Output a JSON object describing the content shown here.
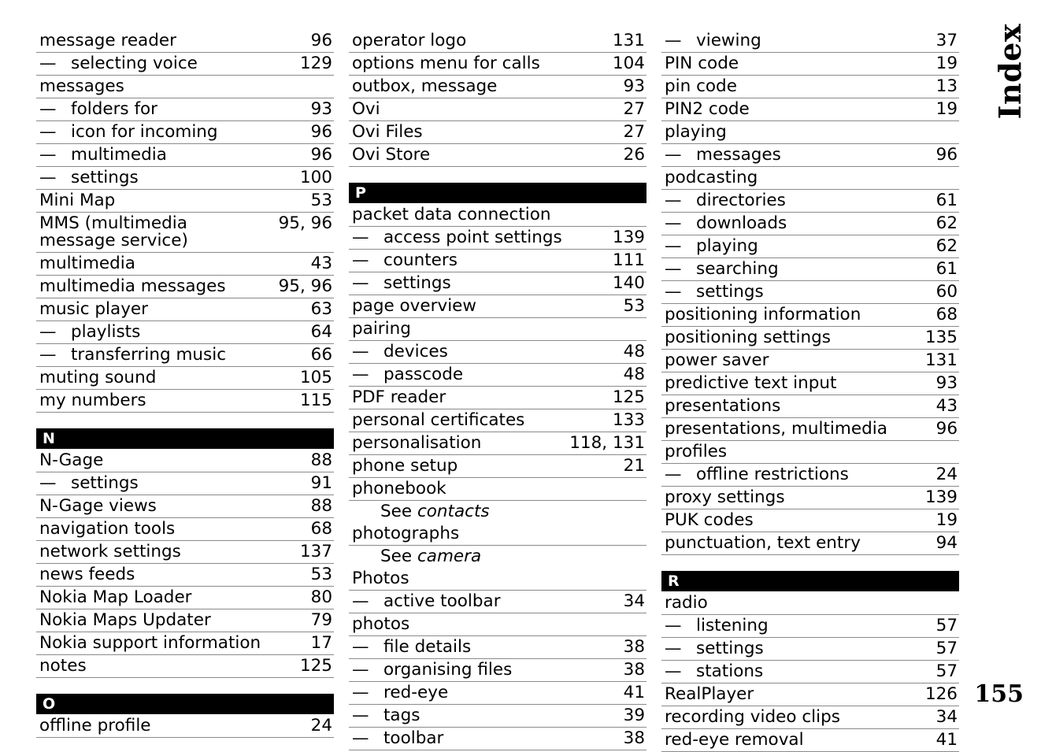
{
  "page": {
    "margin_title": "Index",
    "page_number": "155"
  },
  "columns": [
    {
      "blocks": [
        {
          "type": "entries",
          "entries": [
            {
              "kind": "main",
              "label": "message reader",
              "pages": "96"
            },
            {
              "kind": "sub",
              "label": "selecting voice",
              "pages": "129"
            },
            {
              "kind": "main",
              "label": "messages",
              "pages": ""
            },
            {
              "kind": "sub",
              "label": "folders for",
              "pages": "93"
            },
            {
              "kind": "sub",
              "label": "icon for incoming",
              "pages": "96"
            },
            {
              "kind": "sub",
              "label": "multimedia",
              "pages": "96"
            },
            {
              "kind": "sub",
              "label": "settings",
              "pages": "100"
            },
            {
              "kind": "main",
              "label": "Mini Map",
              "pages": "53"
            },
            {
              "kind": "wrap",
              "label": "MMS (multimedia message service)",
              "pages": "95, 96"
            },
            {
              "kind": "main",
              "label": "multimedia",
              "pages": "43"
            },
            {
              "kind": "main",
              "label": "multimedia messages",
              "pages": "95, 96"
            },
            {
              "kind": "main",
              "label": "music player",
              "pages": "63"
            },
            {
              "kind": "sub",
              "label": "playlists",
              "pages": "64"
            },
            {
              "kind": "sub",
              "label": "transferring music",
              "pages": "66"
            },
            {
              "kind": "main",
              "label": "muting sound",
              "pages": "105"
            },
            {
              "kind": "main",
              "label": "my numbers",
              "pages": "115"
            }
          ]
        },
        {
          "type": "section",
          "letter": "N",
          "entries": [
            {
              "kind": "main",
              "label": "N-Gage",
              "pages": "88"
            },
            {
              "kind": "sub",
              "label": "settings",
              "pages": "91"
            },
            {
              "kind": "main",
              "label": "N-Gage views",
              "pages": "88"
            },
            {
              "kind": "main",
              "label": "navigation tools",
              "pages": "68"
            },
            {
              "kind": "main",
              "label": "network settings",
              "pages": "137"
            },
            {
              "kind": "main",
              "label": "news feeds",
              "pages": "53"
            },
            {
              "kind": "main",
              "label": "Nokia Map Loader",
              "pages": "80"
            },
            {
              "kind": "main",
              "label": "Nokia Maps Updater",
              "pages": "79"
            },
            {
              "kind": "main",
              "label": "Nokia support information",
              "pages": "17"
            },
            {
              "kind": "main",
              "label": "notes",
              "pages": "125"
            }
          ]
        },
        {
          "type": "section",
          "letter": "O",
          "entries": [
            {
              "kind": "main",
              "label": "offline profile",
              "pages": "24"
            }
          ]
        }
      ]
    },
    {
      "blocks": [
        {
          "type": "entries",
          "entries": [
            {
              "kind": "main",
              "label": "operator logo",
              "pages": "131"
            },
            {
              "kind": "main",
              "label": "options menu for calls",
              "pages": "104"
            },
            {
              "kind": "main",
              "label": "outbox, message",
              "pages": "93"
            },
            {
              "kind": "main",
              "label": "Ovi",
              "pages": "27"
            },
            {
              "kind": "main",
              "label": "Ovi Files",
              "pages": "27"
            },
            {
              "kind": "main",
              "label": "Ovi Store",
              "pages": "26"
            }
          ]
        },
        {
          "type": "section",
          "letter": "P",
          "entries": [
            {
              "kind": "main",
              "label": "packet data connection",
              "pages": ""
            },
            {
              "kind": "sub",
              "label": "access point settings",
              "pages": "139"
            },
            {
              "kind": "sub",
              "label": "counters",
              "pages": "111"
            },
            {
              "kind": "sub",
              "label": "settings",
              "pages": "140"
            },
            {
              "kind": "main",
              "label": "page overview",
              "pages": "53"
            },
            {
              "kind": "main",
              "label": "pairing",
              "pages": ""
            },
            {
              "kind": "sub",
              "label": "devices",
              "pages": "48"
            },
            {
              "kind": "sub",
              "label": "passcode",
              "pages": "48"
            },
            {
              "kind": "main",
              "label": "PDF reader",
              "pages": "125"
            },
            {
              "kind": "main",
              "label": "personal certificates",
              "pages": "133"
            },
            {
              "kind": "main",
              "label": "personalisation",
              "pages": "118, 131"
            },
            {
              "kind": "main",
              "label": "phone setup",
              "pages": "21"
            },
            {
              "kind": "main",
              "label": "phonebook",
              "pages": ""
            },
            {
              "kind": "see",
              "see_word": "See",
              "see_target": "contacts"
            },
            {
              "kind": "main",
              "label": "photographs",
              "pages": ""
            },
            {
              "kind": "see",
              "see_word": "See",
              "see_target": "camera"
            },
            {
              "kind": "main",
              "label": "Photos",
              "pages": ""
            },
            {
              "kind": "sub",
              "label": "active toolbar",
              "pages": "34"
            },
            {
              "kind": "main",
              "label": "photos",
              "pages": ""
            },
            {
              "kind": "sub",
              "label": "file details",
              "pages": "38"
            },
            {
              "kind": "sub",
              "label": "organising files",
              "pages": "38"
            },
            {
              "kind": "sub",
              "label": "red-eye",
              "pages": "41"
            },
            {
              "kind": "sub",
              "label": "tags",
              "pages": "39"
            },
            {
              "kind": "sub",
              "label": "toolbar",
              "pages": "38"
            }
          ]
        }
      ]
    },
    {
      "blocks": [
        {
          "type": "entries",
          "entries": [
            {
              "kind": "sub",
              "label": "viewing",
              "pages": "37"
            },
            {
              "kind": "main",
              "label": "PIN code",
              "pages": "19"
            },
            {
              "kind": "main",
              "label": "pin code",
              "pages": "13"
            },
            {
              "kind": "main",
              "label": "PIN2 code",
              "pages": "19"
            },
            {
              "kind": "main",
              "label": "playing",
              "pages": ""
            },
            {
              "kind": "sub",
              "label": "messages",
              "pages": "96"
            },
            {
              "kind": "main",
              "label": "podcasting",
              "pages": ""
            },
            {
              "kind": "sub",
              "label": "directories",
              "pages": "61"
            },
            {
              "kind": "sub",
              "label": "downloads",
              "pages": "62"
            },
            {
              "kind": "sub",
              "label": "playing",
              "pages": "62"
            },
            {
              "kind": "sub",
              "label": "searching",
              "pages": "61"
            },
            {
              "kind": "sub",
              "label": "settings",
              "pages": "60"
            },
            {
              "kind": "main",
              "label": "positioning information",
              "pages": "68"
            },
            {
              "kind": "main",
              "label": "positioning settings",
              "pages": "135"
            },
            {
              "kind": "main",
              "label": "power saver",
              "pages": "131"
            },
            {
              "kind": "main",
              "label": "predictive text input",
              "pages": "93"
            },
            {
              "kind": "main",
              "label": "presentations",
              "pages": "43"
            },
            {
              "kind": "main",
              "label": "presentations, multimedia",
              "pages": "96"
            },
            {
              "kind": "main",
              "label": "profiles",
              "pages": ""
            },
            {
              "kind": "sub",
              "label": "offline restrictions",
              "pages": "24"
            },
            {
              "kind": "main",
              "label": "proxy settings",
              "pages": "139"
            },
            {
              "kind": "main",
              "label": "PUK codes",
              "pages": "19"
            },
            {
              "kind": "main",
              "label": "punctuation, text entry",
              "pages": "94"
            }
          ]
        },
        {
          "type": "section",
          "letter": "R",
          "entries": [
            {
              "kind": "main",
              "label": "radio",
              "pages": ""
            },
            {
              "kind": "sub",
              "label": "listening",
              "pages": "57"
            },
            {
              "kind": "sub",
              "label": "settings",
              "pages": "57"
            },
            {
              "kind": "sub",
              "label": "stations",
              "pages": "57"
            },
            {
              "kind": "main",
              "label": "RealPlayer",
              "pages": "126"
            },
            {
              "kind": "main",
              "label": "recording video clips",
              "pages": "34"
            },
            {
              "kind": "main",
              "label": "red-eye removal",
              "pages": "41"
            }
          ]
        }
      ]
    }
  ]
}
